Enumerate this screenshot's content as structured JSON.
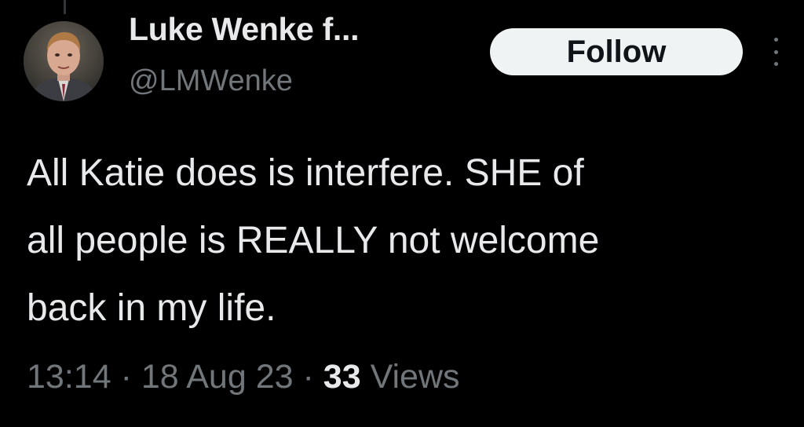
{
  "author": {
    "display_name": "Luke Wenke f...",
    "handle": "@LMWenke"
  },
  "follow_button": {
    "label": "Follow"
  },
  "more_icon": "more-vertical-icon",
  "tweet": {
    "text": "All Katie does is interfere.  SHE of\nall people is REALLY not welcome\nback in my life."
  },
  "meta": {
    "time": "13:14",
    "separator": "·",
    "date": "18 Aug 23",
    "views_count": "33",
    "views_label": "Views"
  },
  "colors": {
    "background": "#000000",
    "primary_text": "#e7e9ea",
    "secondary_text": "#71767b",
    "follow_button_bg": "#eff3f4",
    "follow_button_text": "#0f1419"
  }
}
